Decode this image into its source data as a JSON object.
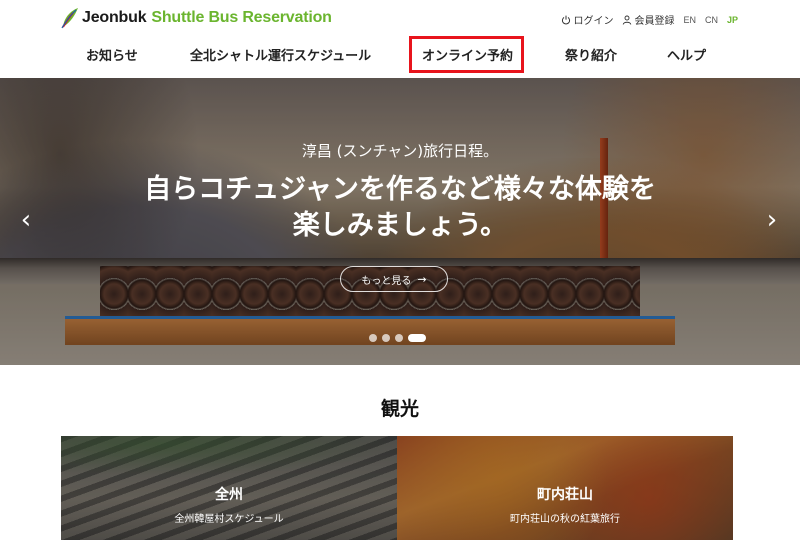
{
  "header": {
    "brand_primary": "Jeonbuk",
    "brand_secondary": "Shuttle Bus Reservation",
    "brand_color": "#6bb52f",
    "util": {
      "login": "ログイン",
      "login_icon": "power-icon",
      "signup": "会員登録",
      "signup_icon": "user-icon",
      "languages": [
        "EN",
        "CN",
        "JP"
      ],
      "active_language": "JP"
    },
    "nav": [
      {
        "label": "お知らせ"
      },
      {
        "label": "全北シャトル運行スケジュール"
      },
      {
        "label": "オンライン予約",
        "highlighted": true
      },
      {
        "label": "祭り紹介"
      },
      {
        "label": "ヘルプ"
      }
    ],
    "highlight_color": "#e8141c"
  },
  "hero": {
    "subtitle": "淳昌 (スンチャン)旅行日程。",
    "headline_line1": "自らコチュジャンを作るなど様々な体験を",
    "headline_line2": "楽しみましょう。",
    "more_button": "もっと見る",
    "more_icon": "arrow-right-icon",
    "prev_icon": "chevron-left-icon",
    "next_icon": "chevron-right-icon",
    "slides_total": 4,
    "active_slide": 4
  },
  "tourism": {
    "title": "観光",
    "cards": [
      {
        "title": "全州",
        "subtitle": "全州韓屋村スケジュール"
      },
      {
        "title": "町内荘山",
        "subtitle": "町内荘山の秋の紅葉旅行"
      }
    ]
  }
}
